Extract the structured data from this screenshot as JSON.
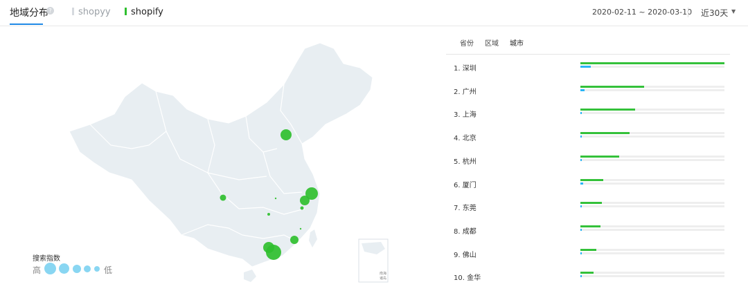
{
  "header": {
    "main_tab": "地域分布",
    "help_icon": "?",
    "legend": [
      {
        "label": "shopyy",
        "color": "#d6dadf"
      },
      {
        "label": "shopify",
        "color": "#2fbf2f"
      }
    ],
    "date_range": "2020-02-11 ~ 2020-03-10",
    "range_select": "近30天"
  },
  "map": {
    "legend_title": "搜索指数",
    "legend_high": "高",
    "legend_low": "低",
    "legend_dot_color": "#89d6f2",
    "bubble_color": "#2fbf2f",
    "land_color": "#e8eef2",
    "islands_label_1": "南海",
    "islands_label_2": "诸岛"
  },
  "list": {
    "sub_tabs": [
      "省份",
      "区域",
      "城市"
    ],
    "active_sub_tab": "城市",
    "rows": [
      {
        "label": "1.  深圳",
        "shopify": 1.0,
        "shopyy": 0.07
      },
      {
        "label": "2.  广州",
        "shopify": 0.44,
        "shopyy": 0.03
      },
      {
        "label": "3.  上海",
        "shopify": 0.38,
        "shopyy": 0.01
      },
      {
        "label": "4.  北京",
        "shopify": 0.34,
        "shopyy": 0.01
      },
      {
        "label": "5.  杭州",
        "shopify": 0.27,
        "shopyy": 0.01
      },
      {
        "label": "6.  厦门",
        "shopify": 0.16,
        "shopyy": 0.02
      },
      {
        "label": "7.  东莞",
        "shopify": 0.15,
        "shopyy": 0.01
      },
      {
        "label": "8.  成都",
        "shopify": 0.14,
        "shopyy": 0.01
      },
      {
        "label": "9.  佛山",
        "shopify": 0.11,
        "shopyy": 0.01
      },
      {
        "label": "10. 金华",
        "shopify": 0.09,
        "shopyy": 0.01
      }
    ]
  }
}
